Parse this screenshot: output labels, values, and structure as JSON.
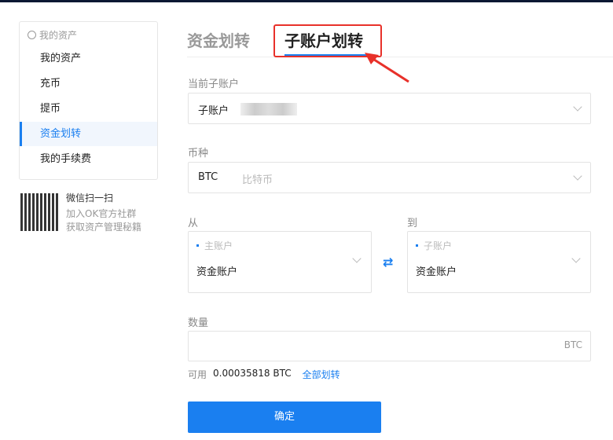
{
  "sidebar": {
    "header": "我的资产",
    "items": [
      {
        "label": "我的资产"
      },
      {
        "label": "充币"
      },
      {
        "label": "提币"
      },
      {
        "label": "资金划转",
        "active": true
      },
      {
        "label": "我的手续费"
      }
    ]
  },
  "promo": {
    "line1": "微信扫一扫",
    "line2": "加入OK官方社群",
    "line3": "获取资产管理秘籍"
  },
  "tabs": [
    {
      "label": "资金划转"
    },
    {
      "label": "子账户划转",
      "active": true
    }
  ],
  "form": {
    "sub_account_label": "当前子账户",
    "sub_account_value": "子账户",
    "coin_label": "币种",
    "coin_value": "BTC",
    "coin_name": "比特币",
    "from_label": "从",
    "from_type": "主账户",
    "from_value": "资金账户",
    "to_label": "到",
    "to_type": "子账户",
    "to_value": "资金账户",
    "amount_label": "数量",
    "amount_unit": "BTC",
    "available_label": "可用",
    "available_value": "0.00035818 BTC",
    "transfer_all": "全部划转",
    "submit": "确定"
  },
  "colors": {
    "accent": "#1a7ff0",
    "highlight": "#e8312a"
  }
}
